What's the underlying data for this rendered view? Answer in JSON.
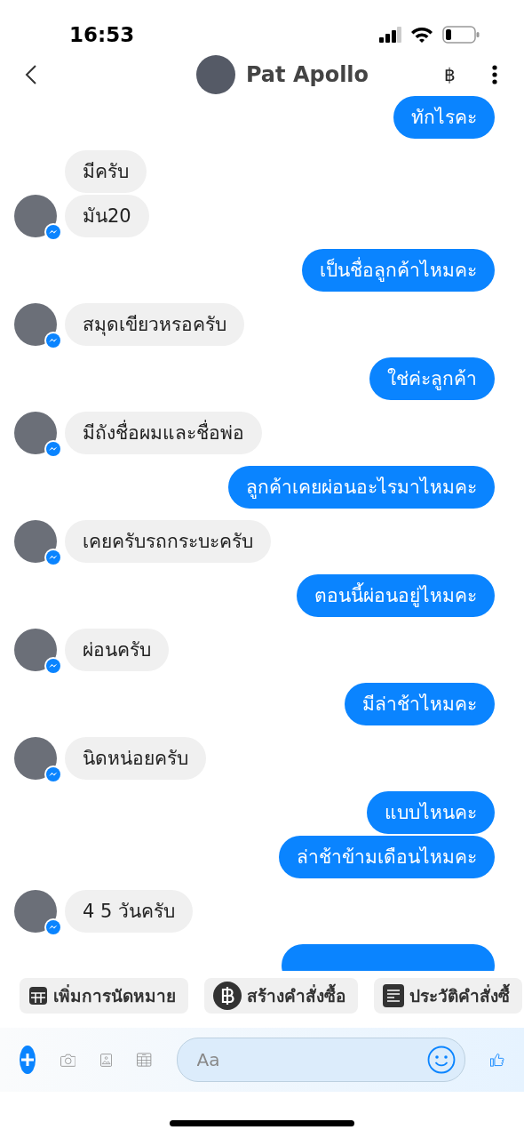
{
  "status_bar": {
    "time": "16:53"
  },
  "header": {
    "contact_name": "Pat Apollo",
    "currency_symbol": "฿"
  },
  "messages": [
    {
      "kind": "out",
      "text": "ทักไรคะ"
    },
    {
      "kind": "in",
      "text": "มีครับ",
      "avatar": false
    },
    {
      "kind": "in",
      "text": "มัน20",
      "avatar": true
    },
    {
      "kind": "out",
      "text": "เป็นชื่อลูกค้าไหมคะ"
    },
    {
      "kind": "in",
      "text": "สมุดเขียวหรอครับ",
      "avatar": true
    },
    {
      "kind": "out",
      "text": "ใช่ค่ะลูกค้า"
    },
    {
      "kind": "in",
      "text": "มีถังชื่อผมและชื่อพ่อ",
      "avatar": true
    },
    {
      "kind": "out",
      "text": "ลูกค้าเคยผ่อนอะไรมาไหมคะ"
    },
    {
      "kind": "in",
      "text": "เคยครับรถกระบะครับ",
      "avatar": true
    },
    {
      "kind": "out",
      "text": "ตอนนี้ผ่อนอยู่ไหมคะ"
    },
    {
      "kind": "in",
      "text": "ผ่อนครับ",
      "avatar": true
    },
    {
      "kind": "out",
      "text": "มีล่าช้าไหมคะ"
    },
    {
      "kind": "in",
      "text": "นิดหน่อยครับ",
      "avatar": true
    },
    {
      "kind": "out",
      "text": "แบบไหนคะ"
    },
    {
      "kind": "out",
      "text": "ล่าช้าข้ามเดือนไหมคะ"
    },
    {
      "kind": "in",
      "text": "4  5  วันครับ",
      "avatar": true
    },
    {
      "kind": "out_partial"
    }
  ],
  "quick_actions": [
    {
      "kind": "calendar",
      "label": "เพิ่มการนัดหมาย"
    },
    {
      "kind": "baht",
      "label": "สร้างคำสั่งซื้อ"
    },
    {
      "kind": "list",
      "label": "ประวัติคำสั่งซื้"
    }
  ],
  "composer": {
    "placeholder": "Aa"
  }
}
